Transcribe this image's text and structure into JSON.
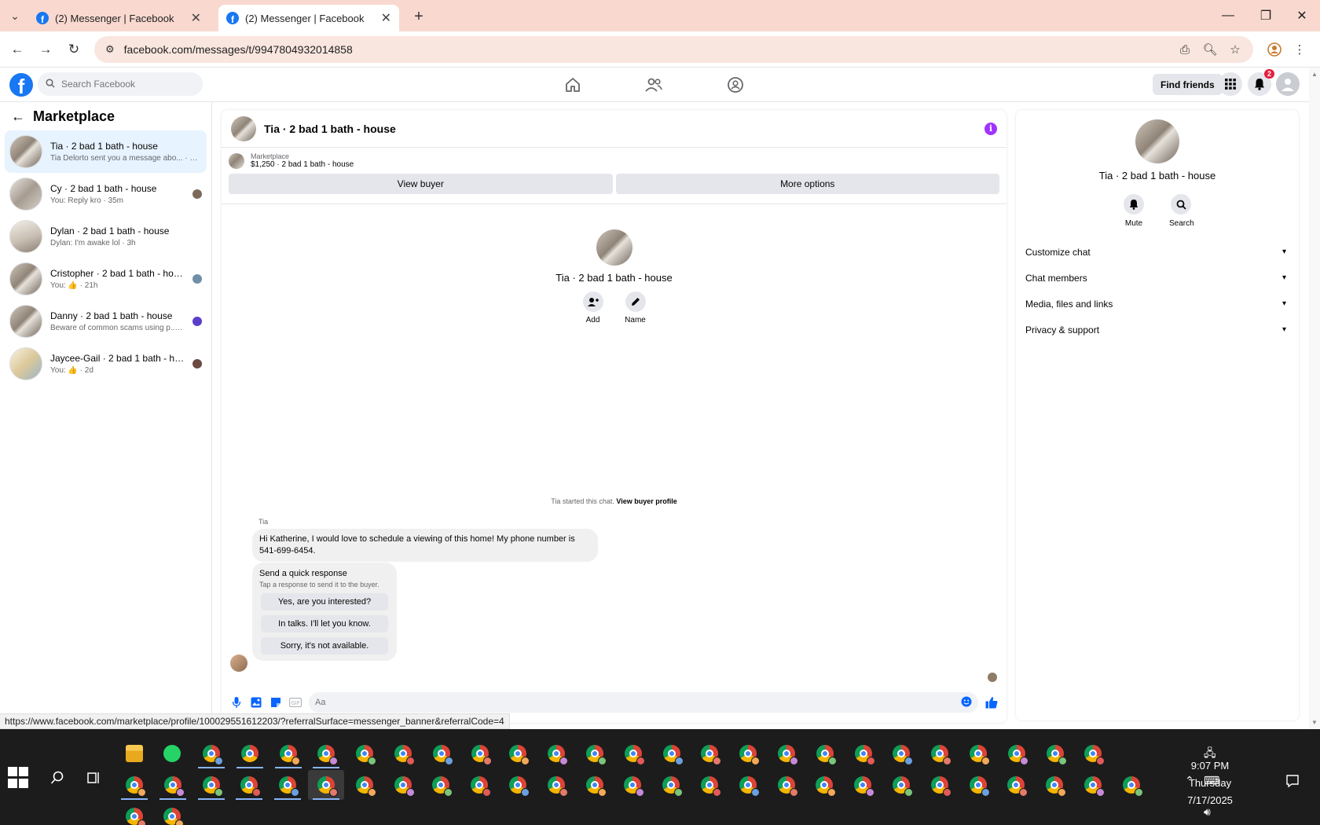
{
  "browser": {
    "tabs": [
      {
        "title": "(2) Messenger | Facebook",
        "active": false
      },
      {
        "title": "(2) Messenger | Facebook",
        "active": true
      }
    ],
    "url": "facebook.com/messages/t/9947804932014858",
    "status_url": "https://www.facebook.com/marketplace/profile/100029551612203/?referralSurface=messenger_banner&referralCode=4"
  },
  "header": {
    "search_placeholder": "Search Facebook",
    "find_friends": "Find friends",
    "notification_count": "2"
  },
  "sidebar": {
    "title": "Marketplace",
    "conversations": [
      {
        "name": "Tia · 2 bad 1 bath - house",
        "preview": "Tia Delorto sent you a message abo... · 23m",
        "active": true
      },
      {
        "name": "Cy · 2 bad 1 bath - house",
        "preview": "You: Reply kro · 35m",
        "active": false
      },
      {
        "name": "Dylan · 2 bad 1 bath - house",
        "preview": "Dylan: I'm awake lol · 3h",
        "active": false
      },
      {
        "name": "Cristopher · 2 bad 1 bath - house",
        "preview": "You: 👍 · 21h",
        "active": false
      },
      {
        "name": "Danny · 2 bad 1 bath - house",
        "preview": "Beware of common scams using p... · 1d",
        "active": false
      },
      {
        "name": "Jaycee-Gail · 2 bad 1 bath - house",
        "preview": "You: 👍 · 2d",
        "active": false
      }
    ]
  },
  "chat": {
    "title": "Tia · 2 bad 1 bath - house",
    "listing_label": "Marketplace",
    "listing_price": "$1,250 · 2 bad 1 bath - house",
    "view_buyer": "View buyer",
    "more_options": "More options",
    "intro_name": "Tia · 2 bad 1 bath - house",
    "add_label": "Add",
    "name_label": "Name",
    "started_text": "Tia started this chat.",
    "view_buyer_profile": "View buyer profile",
    "sender": "Tia",
    "message": "Hi Katherine, I would love to schedule a viewing of this home! My phone number is 541-699-6454.",
    "quick_title": "Send a quick response",
    "quick_sub": "Tap a response to send it to the buyer.",
    "quick_replies": [
      "Yes, are you interested?",
      "In talks. I'll let you know.",
      "Sorry, it's not available."
    ],
    "composer_placeholder": "Aa"
  },
  "right_panel": {
    "name": "Tia · 2 bad 1 bath - house",
    "mute": "Mute",
    "search": "Search",
    "sections": [
      "Customize chat",
      "Chat members",
      "Media, files and links",
      "Privacy & support"
    ]
  },
  "taskbar": {
    "time": "9:07 PM",
    "day": "Thursday",
    "date": "7/17/2025"
  },
  "colors": {
    "brand": "#1877f2",
    "tabstrip": "#f9d9cf",
    "active_conversation": "#e7f3ff",
    "info_icon": "#a033ff"
  }
}
